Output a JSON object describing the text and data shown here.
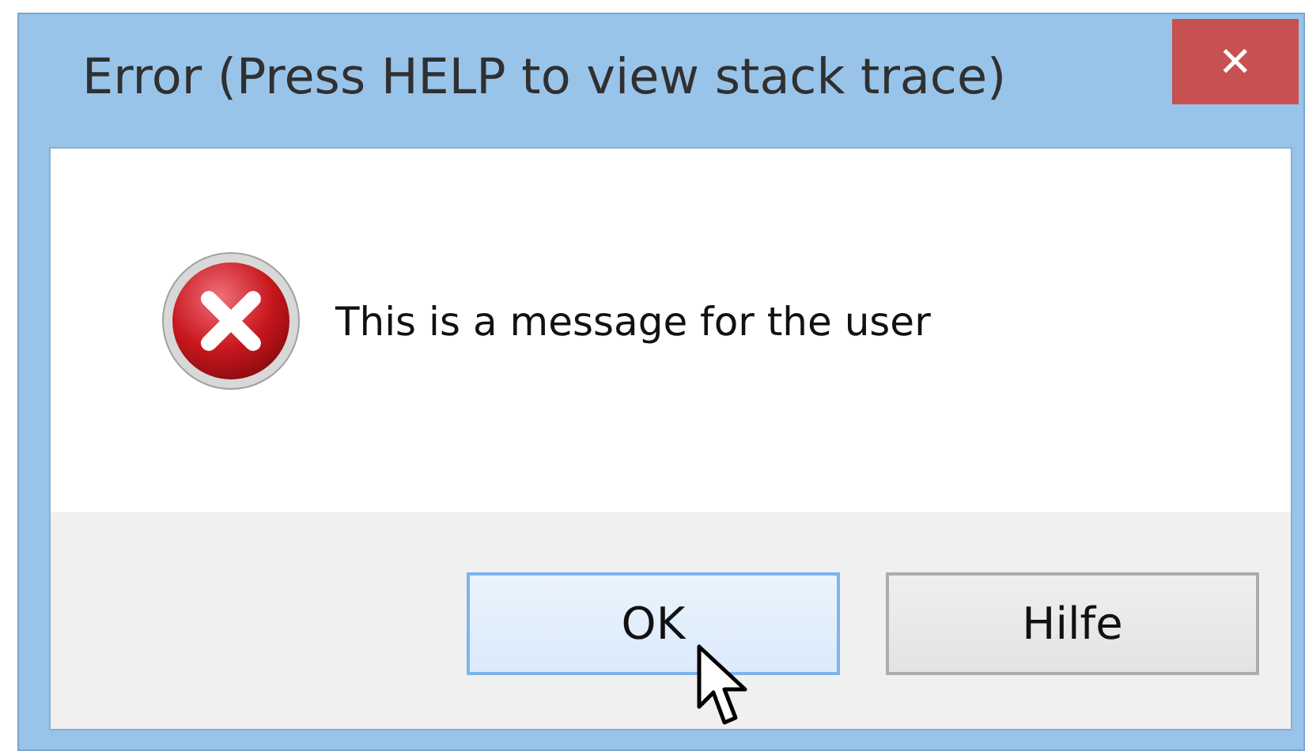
{
  "window": {
    "title": "Error (Press HELP to view stack trace)",
    "close": "✕"
  },
  "message": {
    "kind": "error",
    "text": "This is a message for the user"
  },
  "buttons": [
    {
      "label": "OK",
      "focused": true
    },
    {
      "label": "Hilfe",
      "focused": false
    }
  ]
}
